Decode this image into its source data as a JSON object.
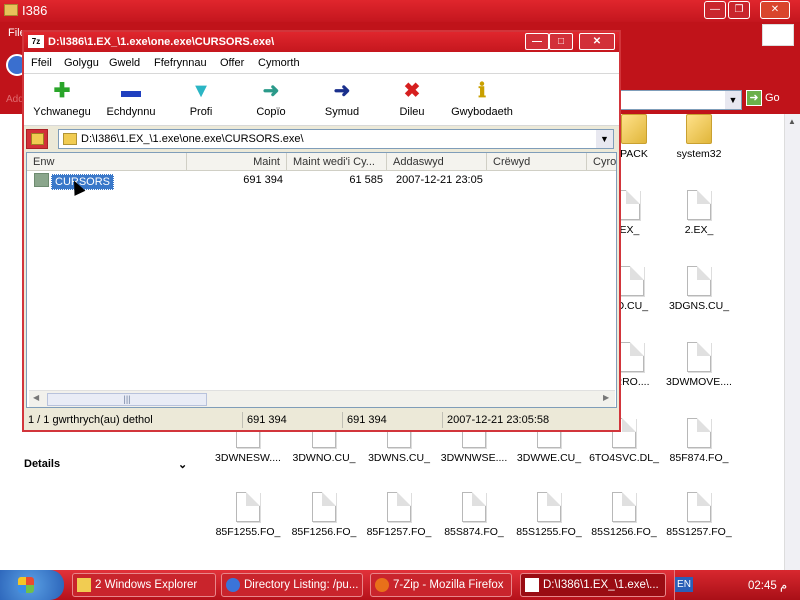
{
  "bg_window": {
    "title": "I386",
    "menu_first": "File",
    "address_label": "Address",
    "go_label": "Go",
    "details_label": "Details"
  },
  "bg_icons": [
    {
      "label": "PACK",
      "kind": "folder"
    },
    {
      "label": "system32",
      "kind": "folder"
    },
    {
      "label": ".EX_",
      "kind": "doc"
    },
    {
      "label": "2.EX_",
      "kind": "doc"
    },
    {
      "label": "O.CU_",
      "kind": "doc"
    },
    {
      "label": "3DGNS.CU_",
      "kind": "doc"
    },
    {
      "label": "RRO....",
      "kind": "doc"
    },
    {
      "label": "3DWMOVE....",
      "kind": "doc"
    },
    {
      "label": "3DWNESW....",
      "kind": "doc"
    },
    {
      "label": "3DWNO.CU_",
      "kind": "doc"
    },
    {
      "label": "3DWNS.CU_",
      "kind": "doc"
    },
    {
      "label": "3DWNWSE....",
      "kind": "doc"
    },
    {
      "label": "3DWWE.CU_",
      "kind": "doc"
    },
    {
      "label": "6TO4SVC.DL_",
      "kind": "doc"
    },
    {
      "label": "85F874.FO_",
      "kind": "doc"
    },
    {
      "label": "85F1255.FO_",
      "kind": "doc"
    },
    {
      "label": "85F1256.FO_",
      "kind": "doc"
    },
    {
      "label": "85F1257.FO_",
      "kind": "doc"
    },
    {
      "label": "85S874.FO_",
      "kind": "doc"
    },
    {
      "label": "85S1255.FO_",
      "kind": "doc"
    },
    {
      "label": "85S1256.FO_",
      "kind": "doc"
    },
    {
      "label": "85S1257.FO_",
      "kind": "doc"
    }
  ],
  "zip": {
    "logo": "7z",
    "title": "D:\\I386\\1.EX_\\1.exe\\one.exe\\CURSORS.exe\\",
    "menu": [
      "Ffeil",
      "Golygu",
      "Gweld",
      "Ffefrynnau",
      "Offer",
      "Cymorth"
    ],
    "toolbar": [
      {
        "label": "Ychwanegu",
        "icon": "plus-icon",
        "color": "#2aa52a"
      },
      {
        "label": "Echdynnu",
        "icon": "minus-icon",
        "color": "#1f3fbf"
      },
      {
        "label": "Profi",
        "icon": "check-icon",
        "color": "#2bb5c4"
      },
      {
        "label": "Copïo",
        "icon": "copy-arrow-icon",
        "color": "#2b9a8a"
      },
      {
        "label": "Symud",
        "icon": "move-arrow-icon",
        "color": "#1a2f8c"
      },
      {
        "label": "Dileu",
        "icon": "delete-x-icon",
        "color": "#d61f1f"
      },
      {
        "label": "Gwybodaeth",
        "icon": "info-icon",
        "color": "#c9a000"
      }
    ],
    "path": "D:\\I386\\1.EX_\\1.exe\\one.exe\\CURSORS.exe\\",
    "columns": [
      "Enw",
      "Maint",
      "Maint wedi'i Cy...",
      "Addaswyd",
      "Crëwyd",
      "Cyro"
    ],
    "rows": [
      {
        "name": "CURSORS",
        "size": "691 394",
        "packed": "61 585",
        "modified": "2007-12-21 23:05"
      }
    ],
    "status": {
      "selected": "1 / 1 gwrthrych(au) dethol",
      "size": "691 394",
      "packed": "691 394",
      "date": "2007-12-21 23:05:58"
    }
  },
  "taskbar": {
    "tasks": [
      {
        "label": "2 Windows Explorer"
      },
      {
        "label": "Directory Listing: /pu..."
      },
      {
        "label": "7-Zip - Mozilla Firefox"
      },
      {
        "label": "D:\\I386\\1.EX_\\1.exe\\..."
      }
    ],
    "lang": "EN",
    "clock": "02:45 م"
  }
}
